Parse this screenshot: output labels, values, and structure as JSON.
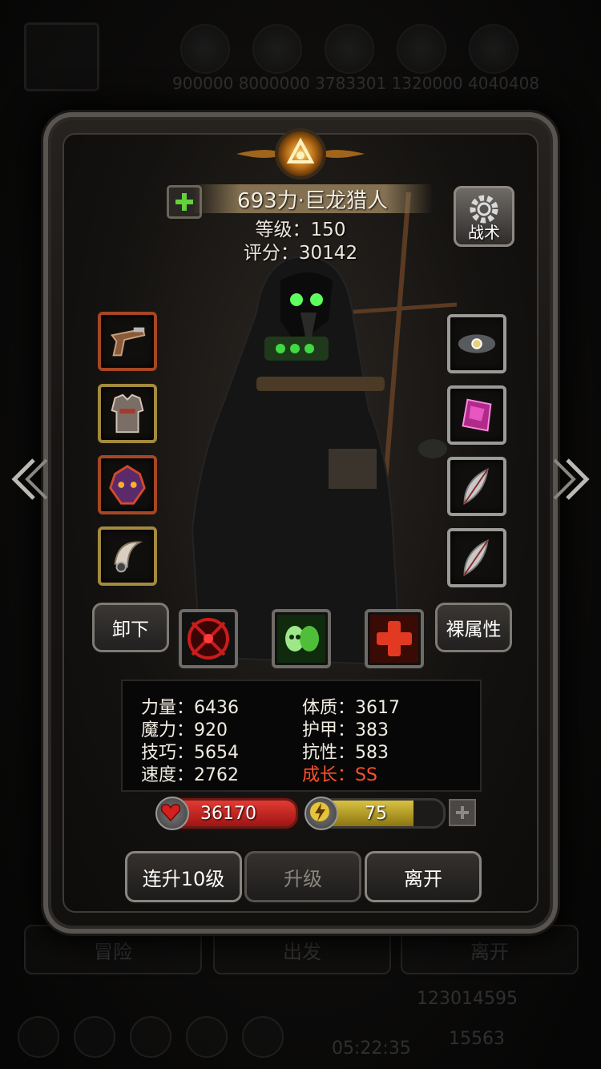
{
  "background": {
    "top_numbers": "900000 8000000 3783301 1320000 4040408",
    "bottom_buttons": [
      "冒险",
      "出发",
      "离开"
    ],
    "gold": "123014595",
    "gems": "15563",
    "timer": "05:22:35"
  },
  "hero": {
    "name": "693力·巨龙猎人",
    "level": "等级：150",
    "score": "评分：30142"
  },
  "tactics_label": "战术",
  "equip_left": [
    {
      "icon": "pistol-icon",
      "rarity": "red"
    },
    {
      "icon": "armor-icon",
      "rarity": "yellow"
    },
    {
      "icon": "demon-mask-icon",
      "rarity": "red"
    },
    {
      "icon": "horn-ring-icon",
      "rarity": "yellow"
    }
  ],
  "equip_right": [
    {
      "icon": "storm-amulet-icon",
      "rarity": "silver"
    },
    {
      "icon": "crystal-icon",
      "rarity": "silver"
    },
    {
      "icon": "feather-icon",
      "rarity": "silver"
    },
    {
      "icon": "feather-icon",
      "rarity": "silver"
    }
  ],
  "unequip_label": "卸下",
  "base_attr_label": "裸属性",
  "skills": [
    {
      "icon": "target-skill-icon",
      "color": "#c81d1d"
    },
    {
      "icon": "skull-skill-icon",
      "color": "#4fbf3a"
    },
    {
      "icon": "heal-cross-skill-icon",
      "color": "#e23a22"
    }
  ],
  "stats": {
    "strength": "力量：6436",
    "magic": "魔力：920",
    "skill": "技巧：5654",
    "speed": "速度：2762",
    "constitution": "体质：3617",
    "armor": "护甲：383",
    "resistance": "抗性：583",
    "growth": "成长：SS"
  },
  "growth_color": "#ff4f2c",
  "hp": "36170",
  "energy": {
    "value": "75",
    "fill": 0.78
  },
  "buttons": {
    "level_up_10": "连升10级",
    "level_up": "升级",
    "leave": "离开"
  }
}
